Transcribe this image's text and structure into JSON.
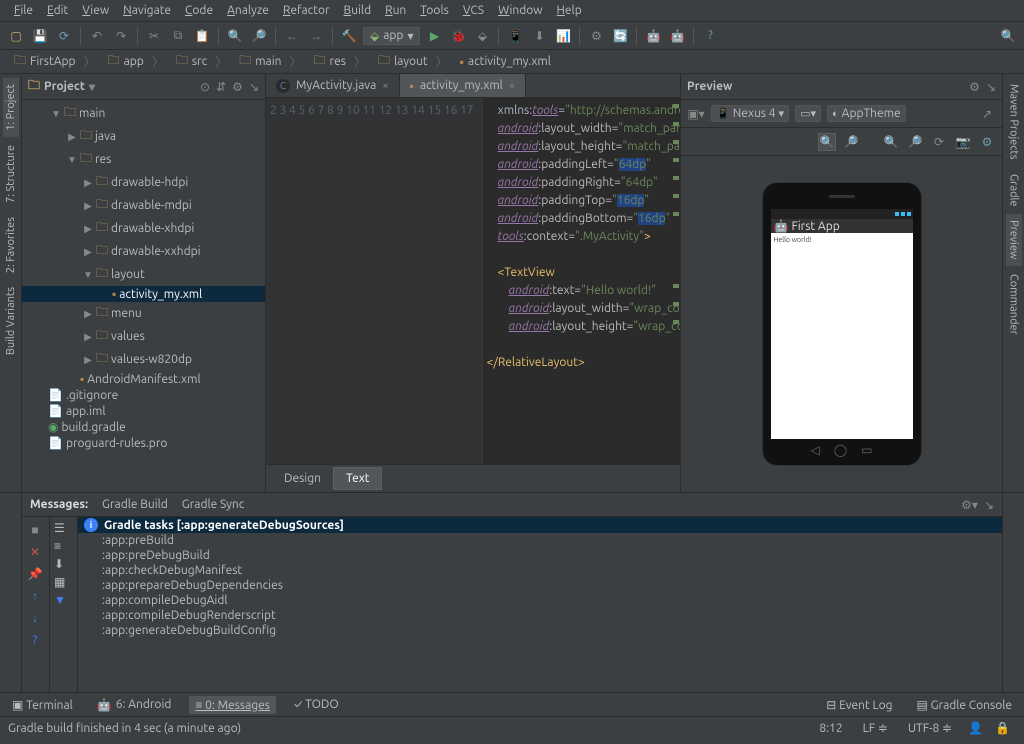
{
  "menu": [
    "File",
    "Edit",
    "View",
    "Navigate",
    "Code",
    "Analyze",
    "Refactor",
    "Build",
    "Run",
    "Tools",
    "VCS",
    "Window",
    "Help"
  ],
  "run_config": "app",
  "breadcrumb": [
    "FirstApp",
    "app",
    "src",
    "main",
    "res",
    "layout",
    "activity_my.xml"
  ],
  "left_tabs": [
    {
      "label": "1: Project",
      "active": true
    },
    {
      "label": "7: Structure",
      "active": false
    },
    {
      "label": "2: Favorites",
      "active": false
    },
    {
      "label": "Build Variants",
      "active": false
    }
  ],
  "right_tabs": [
    {
      "label": "Maven Projects",
      "active": false,
      "icon": "m"
    },
    {
      "label": "Gradle",
      "active": false
    },
    {
      "label": "Preview",
      "active": true
    },
    {
      "label": "Commander",
      "active": false
    }
  ],
  "project_panel_title": "Project",
  "tree": [
    {
      "depth": 0,
      "arrow": "▼",
      "icon": "folder",
      "label": "main"
    },
    {
      "depth": 1,
      "arrow": "▶",
      "icon": "folder",
      "label": "java"
    },
    {
      "depth": 1,
      "arrow": "▼",
      "icon": "folder",
      "label": "res"
    },
    {
      "depth": 2,
      "arrow": "▶",
      "icon": "folder",
      "label": "drawable-hdpi"
    },
    {
      "depth": 2,
      "arrow": "▶",
      "icon": "folder",
      "label": "drawable-mdpi"
    },
    {
      "depth": 2,
      "arrow": "▶",
      "icon": "folder",
      "label": "drawable-xhdpi"
    },
    {
      "depth": 2,
      "arrow": "▶",
      "icon": "folder",
      "label": "drawable-xxhdpi"
    },
    {
      "depth": 2,
      "arrow": "▼",
      "icon": "folder",
      "label": "layout"
    },
    {
      "depth": 3,
      "arrow": "",
      "icon": "xml",
      "label": "activity_my.xml",
      "selected": true
    },
    {
      "depth": 2,
      "arrow": "▶",
      "icon": "folder",
      "label": "menu"
    },
    {
      "depth": 2,
      "arrow": "▶",
      "icon": "folder",
      "label": "values"
    },
    {
      "depth": 2,
      "arrow": "▶",
      "icon": "folder",
      "label": "values-w820dp"
    },
    {
      "depth": 1,
      "arrow": "",
      "icon": "xml",
      "label": "AndroidManifest.xml"
    },
    {
      "depth": -1,
      "arrow": "",
      "icon": "file",
      "label": ".gitignore"
    },
    {
      "depth": -1,
      "arrow": "",
      "icon": "file",
      "label": "app.iml"
    },
    {
      "depth": -1,
      "arrow": "",
      "icon": "gradle",
      "label": "build.gradle"
    },
    {
      "depth": -1,
      "arrow": "",
      "icon": "file",
      "label": "proguard-rules.pro"
    }
  ],
  "editor_tabs": [
    {
      "label": "MyActivity.java",
      "icon": "C",
      "active": false
    },
    {
      "label": "activity_my.xml",
      "icon": "xml",
      "active": true
    }
  ],
  "line_start": 2,
  "line_end": 17,
  "code_lines": [
    "    xmlns:<span class='attr'>tools</span>=<span class='str'>\"http://schemas.android.co</span>",
    "    <span class='attr'>android</span><span class='ns'>:layout_width=</span><span class='str'>\"match_parent\"</span>",
    "    <span class='attr'>android</span><span class='ns'>:layout_height=</span><span class='str'>\"match_parent\"</span>",
    "    <span class='attr'>android</span><span class='ns'>:paddingLeft=</span><span class='str'>\"<span class='hl'>64dp</span>\"</span>",
    "    <span class='attr'>android</span><span class='ns'>:paddingRight=</span><span class='str'>\"64dp\"</span>",
    "    <span class='attr'>android</span><span class='ns'>:paddingTop=</span><span class='str'>\"<span class='hl'>16dp</span>\"</span>",
    "    <span class='attr'>android</span><span class='ns'>:paddingBottom=</span><span class='str'>\"<span class='hl'>16dp</span>\"</span>",
    "    <span class='attr'>tools</span><span class='ns'>:context=</span><span class='str'>\".MyActivity\"</span><span class='tag'>&gt;</span>",
    "",
    "    <span class='tag'>&lt;TextView</span>",
    "        <span class='attr'>android</span><span class='ns'>:text=</span><span class='str'>\"Hello world!\"</span>",
    "        <span class='attr'>android</span><span class='ns'>:layout_width=</span><span class='str'>\"wrap_content\"</span>",
    "        <span class='attr'>android</span><span class='ns'>:layout_height=</span><span class='str'>\"wrap_content</span>",
    "",
    "<span class='tag'>&lt;/RelativeLayout&gt;</span>",
    ""
  ],
  "design_tabs": [
    {
      "label": "Design",
      "active": false
    },
    {
      "label": "Text",
      "active": true
    }
  ],
  "preview_title": "Preview",
  "device_label": "Nexus 4",
  "theme_label": "AppTheme",
  "phone_app_title": "First App",
  "phone_text": "Hello world!",
  "messages_tabs": [
    {
      "label": "Messages:",
      "active": true
    },
    {
      "label": "Gradle Build",
      "active": false
    },
    {
      "label": "Gradle Sync",
      "active": false
    }
  ],
  "messages_header": "Gradle tasks [:app:generateDebugSources]",
  "messages_items": [
    ":app:preBuild",
    ":app:preDebugBuild",
    ":app:checkDebugManifest",
    ":app:prepareDebugDependencies",
    ":app:compileDebugAidl",
    ":app:compileDebugRenderscript",
    ":app:generateDebugBuildConfig"
  ],
  "bottom_tabs": [
    {
      "label": "Terminal",
      "icon": "▣"
    },
    {
      "label": "6: Android",
      "icon": "droid"
    },
    {
      "label": "0: Messages",
      "icon": "≡",
      "active": true
    },
    {
      "label": "TODO",
      "icon": "✓"
    }
  ],
  "bottom_right": [
    {
      "label": "Event Log",
      "icon": "⊟"
    },
    {
      "label": "Gradle Console",
      "icon": "▤"
    }
  ],
  "status_text": "Gradle build finished in 4 sec (a minute ago)",
  "cursor_pos": "8:12",
  "line_sep": "LF",
  "encoding": "UTF-8"
}
